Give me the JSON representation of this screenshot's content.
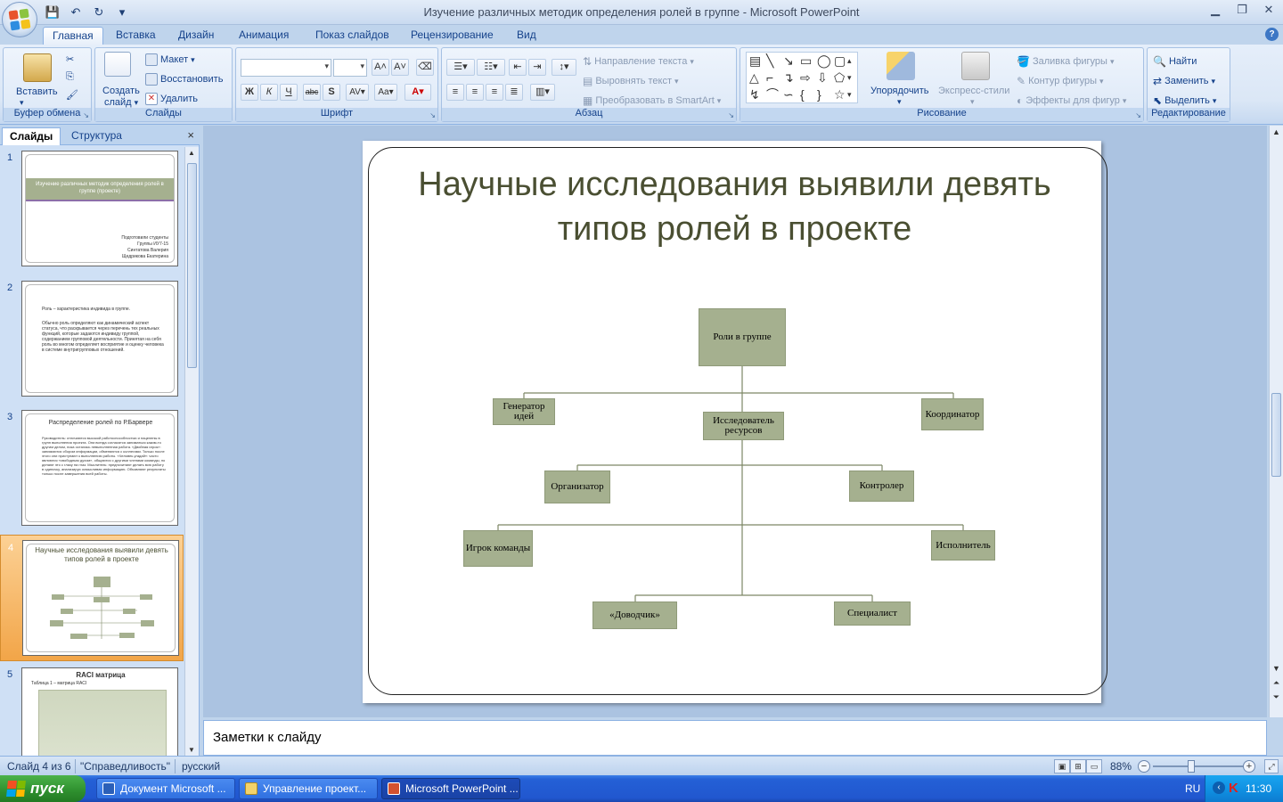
{
  "window": {
    "title": "Изучение различных методик определения ролей в группе - Microsoft PowerPoint"
  },
  "tabs": [
    "Главная",
    "Вставка",
    "Дизайн",
    "Анимация",
    "Показ слайдов",
    "Рецензирование",
    "Вид"
  ],
  "ribbon": {
    "clipboard": {
      "label": "Буфер обмена",
      "paste": "Вставить"
    },
    "slides": {
      "label": "Слайды",
      "new_slide_1": "Создать",
      "new_slide_2": "слайд",
      "layout": "Макет",
      "reset": "Восстановить",
      "delete": "Удалить"
    },
    "font": {
      "label": "Шрифт",
      "font_name": "",
      "font_size": ""
    },
    "paragraph": {
      "label": "Абзац",
      "text_direction": "Направление текста",
      "align_text": "Выровнять текст",
      "smartart": "Преобразовать в SmartArt"
    },
    "drawing": {
      "label": "Рисование",
      "arrange": "Упорядочить",
      "quick_styles": "Экспресс-стили",
      "shape_fill": "Заливка фигуры",
      "shape_outline": "Контур фигуры",
      "shape_effects": "Эффекты для фигур"
    },
    "editing": {
      "label": "Редактирование",
      "find": "Найти",
      "replace": "Заменить",
      "select": "Выделить"
    }
  },
  "pane": {
    "tab_slides": "Слайды",
    "tab_outline": "Структура",
    "close": "×"
  },
  "thumbnails": {
    "s1": {
      "num": "1",
      "title": "Изучение различных методик определения ролей в группе (проекте)",
      "authors": [
        "Подготовили студенты",
        "Группы ИУ7-15",
        "Синтатова Валерия",
        "Щедрикова Екатерина"
      ]
    },
    "s2": {
      "num": "2",
      "bullet1": "Роль – характеристика индивида в группе.",
      "bullet2": "Обычно роль определяют как динамический аспект статуса, что раскрывается через перечень тех реальных функций, которые задаются индивиду группой, содержанием групповой деятельности. Принятая на себя роль во многом определяет восприятие и оценку человека в системе внутригрупповых отношений."
    },
    "s3": {
      "num": "3",
      "title": "Распределение ролей по Р.Барвере",
      "text": "Руководитель: отличаются высокой работоспособностью и нацелены в групп выполнения проекта. Они всегда согласятся заниматься каким-то другим делом, пока осталась невыполненная работа. «Двойная игрок»: занимаются сбором информации, обменяются с коллегами. Только после этого они приступают к выполнению работы. «Человек-угадай»: часто являются «свободным духом», общаются с другими членами команды, но делают это с глазу на глаз. Мыслитель: предпочитают делать всю работу в одиночку, анализируя осмысливая информацию. Объявляют результаты только после завершения всей работы."
    },
    "s4": {
      "num": "4",
      "title": "Научные исследования выявили девять типов ролей в проекте"
    },
    "s5": {
      "num": "5",
      "title": "RACI матрица",
      "subtitle": "Таблица 1 – матрица RACI"
    }
  },
  "slide": {
    "title": "Научные исследования выявили девять типов ролей в проекте",
    "nodes": {
      "root": "Роли в группе",
      "generator": "Генератор идей",
      "researcher": "Исследователь ресурсов",
      "coordinator": "Координатор",
      "organizer": "Организатор",
      "controller": "Контролер",
      "team_player": "Игрок команды",
      "executor": "Исполнитель",
      "finisher": "«Доводчик»",
      "specialist": "Специалист"
    }
  },
  "notes": {
    "placeholder": "Заметки к слайду"
  },
  "status": {
    "slide_info": "Слайд 4 из 6",
    "theme": "\"Справедливость\"",
    "language": "русский",
    "zoom": "88%"
  },
  "taskbar": {
    "start": "пуск",
    "tasks": [
      "Документ Microsoft ...",
      "Управление проект...",
      "Microsoft PowerPoint ..."
    ],
    "lang": "RU",
    "time": "11:30"
  },
  "colors": {
    "node_fill": "#a5b08f",
    "title_color": "#4a4f32",
    "ribbon_text": "#15428b"
  }
}
